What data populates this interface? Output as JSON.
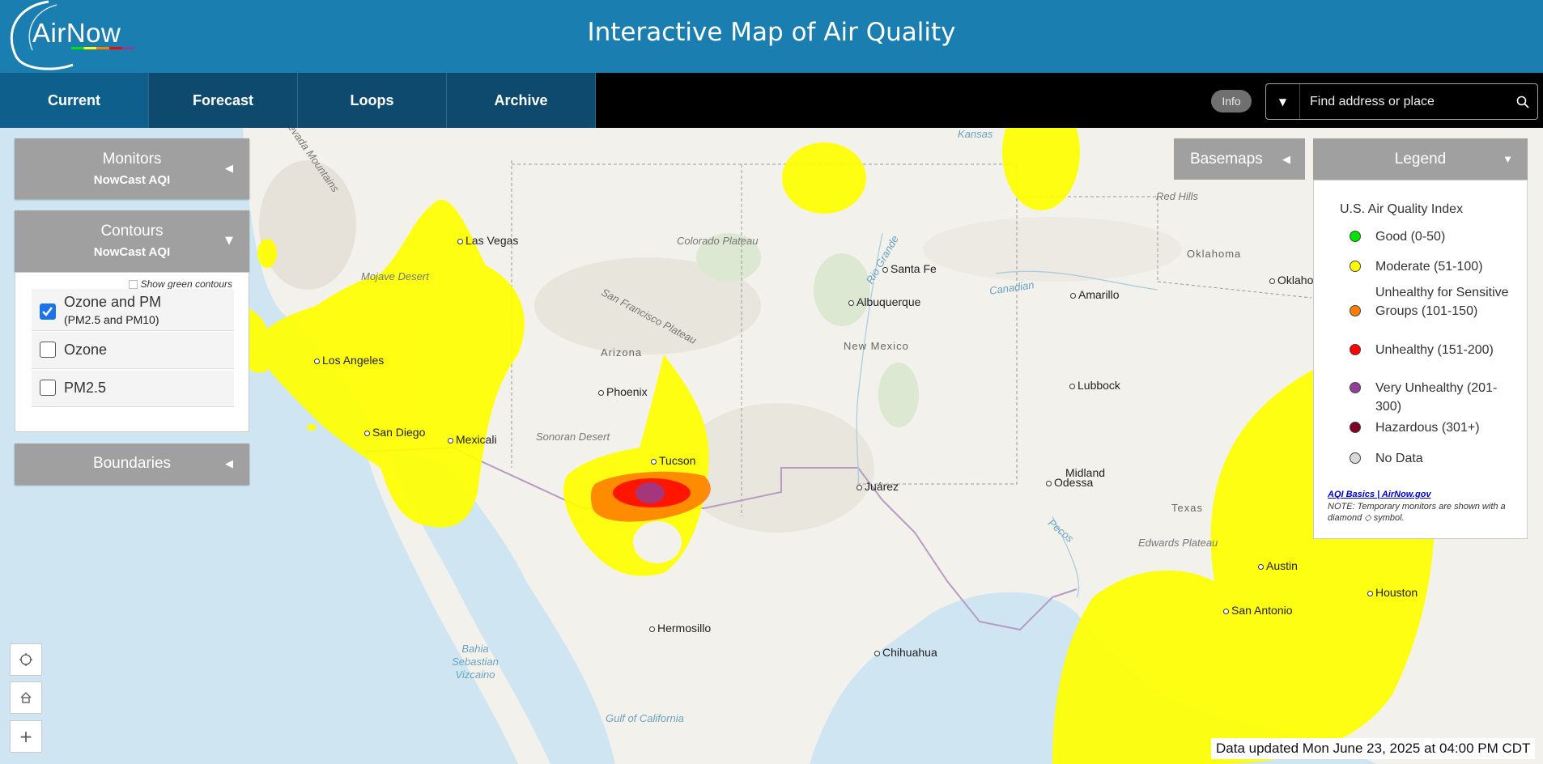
{
  "header": {
    "logo_text": "AirNow",
    "title": "Interactive Map of Air Quality"
  },
  "nav": {
    "tabs": [
      {
        "label": "Current"
      },
      {
        "label": "Forecast"
      },
      {
        "label": "Loops"
      },
      {
        "label": "Archive"
      }
    ],
    "active_tab": "Current",
    "info_label": "Info",
    "search_placeholder": "Find address or place"
  },
  "panels": {
    "monitors": {
      "title": "Monitors",
      "subtitle": "NowCast AQI"
    },
    "contours": {
      "title": "Contours",
      "subtitle": "NowCast AQI",
      "show_green_label": "Show green contours",
      "options": [
        {
          "label": "Ozone and PM",
          "sublabel": "(PM2.5 and PM10)",
          "checked": true
        },
        {
          "label": "Ozone",
          "checked": false
        },
        {
          "label": "PM2.5",
          "checked": false
        }
      ]
    },
    "boundaries": {
      "title": "Boundaries"
    }
  },
  "basemaps": {
    "label": "Basemaps"
  },
  "legend": {
    "header": "Legend",
    "title": "U.S. Air Quality Index",
    "items": [
      {
        "label": "Good (0-50)",
        "color": "#00e400"
      },
      {
        "label": "Moderate (51-100)",
        "color": "#ffff00"
      },
      {
        "label": "Unhealthy for Sensitive Groups (101-150)",
        "color": "#ff7e00"
      },
      {
        "label": "Unhealthy (151-200)",
        "color": "#ff0000"
      },
      {
        "label": "Very Unhealthy (201-300)",
        "color": "#8f3f97"
      },
      {
        "label": "Hazardous (301+)",
        "color": "#7e0023"
      },
      {
        "label": "No Data",
        "color": "#d9d9d9"
      }
    ],
    "link_text": "AQI Basics | AirNow.gov",
    "note": "NOTE: Temporary monitors are shown with a diamond ◇ symbol."
  },
  "map": {
    "cities": [
      "Las Vegas",
      "Los Angeles",
      "San Diego",
      "Mexicali",
      "Phoenix",
      "Tucson",
      "Hermosillo",
      "Santa Fe",
      "Albuquerque",
      "Amarillo",
      "Lubbock",
      "Midland",
      "Odessa",
      "Juárez",
      "Chihuahua",
      "Austin",
      "San Antonio",
      "Houston",
      "Oklaho"
    ],
    "regions": [
      "Mojave Desert",
      "Sonoran Desert",
      "Colorado Plateau",
      "San Francisco Plateau",
      "Arizona",
      "New Mexico",
      "Oklahoma",
      "Texas",
      "Edwards Plateau",
      "Red Hills",
      "Sierra Nevada Mountains"
    ],
    "water": [
      "Gulf of California",
      "Bahia Sebastian Vizcaino",
      "Rio Grande",
      "Canadian",
      "Pecos",
      "Kansas"
    ],
    "aqi_colors": {
      "moderate": "#ffff00",
      "usg": "#ff7e00",
      "unhealthy": "#ff0000",
      "very_unhealthy": "#8f3f97"
    }
  },
  "status": {
    "updated": "Data updated Mon June 23, 2025 at 04:00 PM CDT"
  }
}
